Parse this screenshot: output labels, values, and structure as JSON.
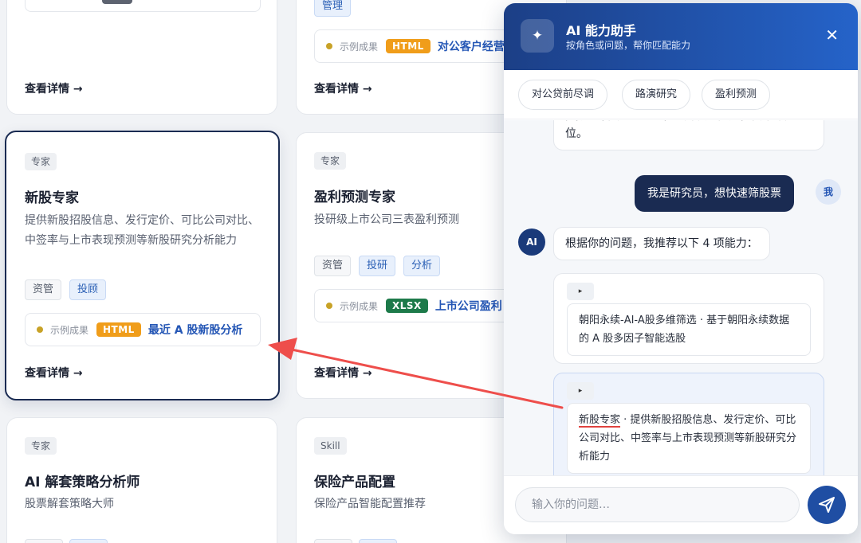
{
  "cards": {
    "top_left": {
      "detail": "查看详情 →"
    },
    "top_mid": {
      "tag": "管理",
      "example_label": "示例成果",
      "example_format": "HTML",
      "example_link": "对公客户经营",
      "detail": "查看详情 →"
    },
    "ipo": {
      "badge": "专家",
      "title": "新股专家",
      "desc": "提供新股招股信息、发行定价、可比公司对比、中签率与上市表现预测等新股研究分析能力",
      "tags": [
        "资管",
        "投顾"
      ],
      "example_label": "示例成果",
      "example_format": "HTML",
      "example_link": "最近 A 股新股分析",
      "detail": "查看详情 →"
    },
    "earnings": {
      "badge": "专家",
      "title": "盈利预测专家",
      "desc": "投研级上市公司三表盈利预测",
      "tags": [
        "资管",
        "投研",
        "分析"
      ],
      "example_label": "示例成果",
      "example_format": "XLSX",
      "example_link": "上市公司盈利",
      "detail": "查看详情 →"
    },
    "unlock": {
      "badge": "专家",
      "title": "AI 解套策略分析师",
      "desc": "股票解套策略大师"
    },
    "insurance": {
      "badge": "Skill",
      "title": "保险产品配置",
      "desc": "保险产品智能配置推荐"
    }
  },
  "assistant": {
    "title": "AI 能力助手",
    "subtitle": "按角色或问题，帮你匹配能力",
    "quick_prompts": [
      "对公贷前尽调",
      "路演研究",
      "盈利预测"
    ],
    "messages": {
      "ai_partial": "资/风控/客户经理）和想解决的问题，我帮你定位。",
      "user": "我是研究员，想快速筛股票",
      "user_avatar": "我",
      "ai_avatar": "AI",
      "ai_reply": "根据你的问题，我推荐以下 4 项能力："
    },
    "recommendations": [
      {
        "toggle": "▸",
        "name": "朝阳永续-AI-A股多维筛选",
        "desc": " · 基于朝阳永续数据的 A 股多因子智能选股"
      },
      {
        "toggle": "▸",
        "name": "新股专家",
        "desc": " · 提供新股招股信息、发行定价、可比公司对比、中签率与上市表现预测等新股研究分析能力"
      }
    ],
    "input_placeholder": "输入你的问题…"
  }
}
